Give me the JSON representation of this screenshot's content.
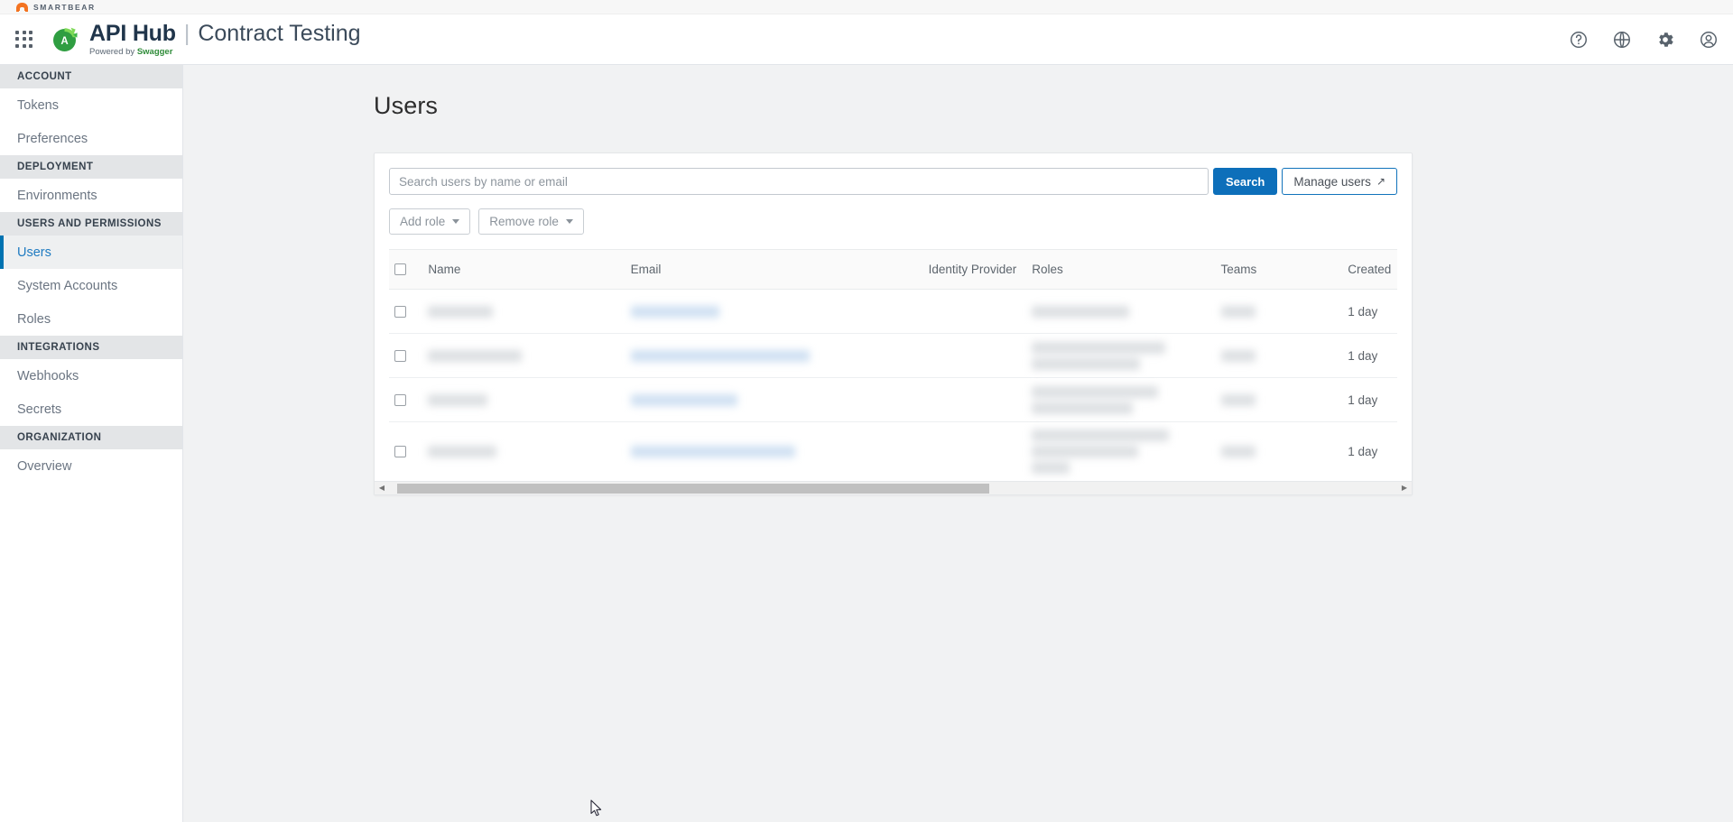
{
  "smartbear_strip": {
    "wordmark": "SMARTBEAR",
    "logo_icon": "smartbear-bear-icon"
  },
  "header": {
    "waffle_icon": "app-grid-icon",
    "brand": {
      "mark_icon": "api-hub-swagger-logo-icon",
      "name": "API Hub",
      "separator": "|",
      "product": "Contract Testing",
      "powered_prefix": "Powered by ",
      "powered_brand": "Swagger"
    },
    "icons": [
      {
        "name": "help-icon",
        "glyph": "?"
      },
      {
        "name": "globe-icon",
        "glyph": "globe"
      },
      {
        "name": "gear-icon",
        "glyph": "gear"
      },
      {
        "name": "account-icon",
        "glyph": "user"
      }
    ]
  },
  "sidebar": {
    "groups": [
      {
        "label": "ACCOUNT",
        "items": [
          {
            "label": "Tokens",
            "active": false
          },
          {
            "label": "Preferences",
            "active": false
          }
        ]
      },
      {
        "label": "DEPLOYMENT",
        "items": [
          {
            "label": "Environments",
            "active": false
          }
        ]
      },
      {
        "label": "USERS AND PERMISSIONS",
        "items": [
          {
            "label": "Users",
            "active": true
          },
          {
            "label": "System Accounts",
            "active": false
          },
          {
            "label": "Roles",
            "active": false
          }
        ]
      },
      {
        "label": "INTEGRATIONS",
        "items": [
          {
            "label": "Webhooks",
            "active": false
          },
          {
            "label": "Secrets",
            "active": false
          }
        ]
      },
      {
        "label": "ORGANIZATION",
        "items": [
          {
            "label": "Overview",
            "active": false
          }
        ]
      }
    ]
  },
  "main": {
    "page_title": "Users",
    "search": {
      "placeholder": "Search users by name or email",
      "value": "",
      "search_button": "Search",
      "manage_users_button": "Manage users",
      "manage_users_arrow": "↗"
    },
    "role_actions": {
      "add_role": "Add role",
      "remove_role": "Remove role"
    },
    "table": {
      "columns": [
        {
          "key": "select",
          "label": ""
        },
        {
          "key": "name",
          "label": "Name"
        },
        {
          "key": "email",
          "label": "Email"
        },
        {
          "key": "idp",
          "label": "Identity Provider"
        },
        {
          "key": "roles",
          "label": "Roles"
        },
        {
          "key": "teams",
          "label": "Teams"
        },
        {
          "key": "created",
          "label": "Created"
        }
      ],
      "rows": [
        {
          "selected": false,
          "name": "",
          "email": "",
          "idp": "",
          "roles": "",
          "teams": "",
          "created": "1 day",
          "redacted": true
        },
        {
          "selected": false,
          "name": "",
          "email": "",
          "idp": "",
          "roles": "",
          "teams": "",
          "created": "1 day",
          "redacted": true
        },
        {
          "selected": false,
          "name": "",
          "email": "",
          "idp": "",
          "roles": "",
          "teams": "",
          "created": "1 day",
          "redacted": true
        },
        {
          "selected": false,
          "name": "",
          "email": "",
          "idp": "",
          "roles": "",
          "teams": "",
          "created": "1 day",
          "redacted": true
        }
      ],
      "horizontal_scroll": {
        "left_arrow": "◀",
        "right_arrow": "▶",
        "thumb_fraction": 0.585
      }
    }
  },
  "colors": {
    "accent_blue": "#0d6fba",
    "active_nav_blue": "#1f7bc1",
    "sidebar_section_bg": "#e3e5e7",
    "page_bg": "#f1f2f3",
    "swagger_green": "#2e8b38",
    "smartbear_orange": "#f37321"
  }
}
